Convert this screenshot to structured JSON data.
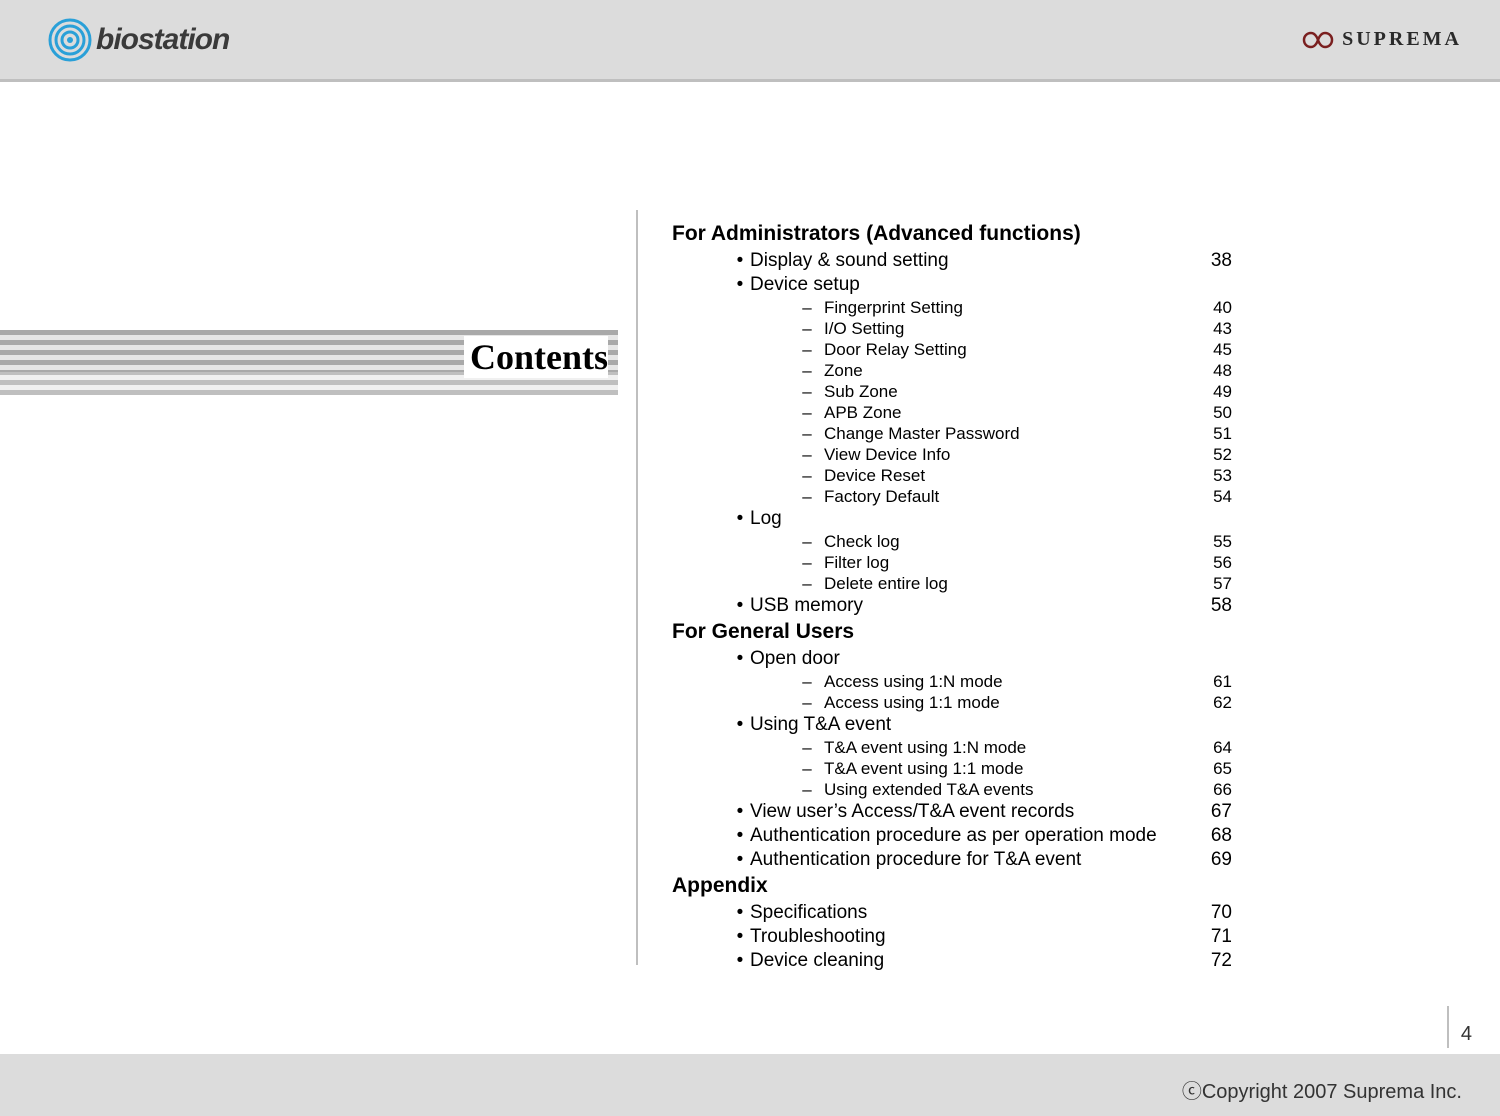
{
  "header": {
    "left_logo_text": "biostation",
    "right_logo_text": "SUPREMA"
  },
  "left": {
    "title": "Contents"
  },
  "toc": {
    "sections": [
      {
        "title": "For Administrators (Advanced functions)",
        "items": [
          {
            "label": "Display & sound setting",
            "page": "38"
          },
          {
            "label": "Device setup",
            "page": "",
            "sub": [
              {
                "label": "Fingerprint Setting",
                "page": "40"
              },
              {
                "label": "I/O Setting",
                "page": "43"
              },
              {
                "label": "Door Relay Setting",
                "page": "45"
              },
              {
                "label": "Zone",
                "page": "48"
              },
              {
                "label": "Sub Zone",
                "page": "49"
              },
              {
                "label": "APB Zone",
                "page": "50"
              },
              {
                "label": "Change Master Password",
                "page": "51"
              },
              {
                "label": "View Device Info",
                "page": "52"
              },
              {
                "label": "Device Reset",
                "page": "53"
              },
              {
                "label": "Factory Default",
                "page": "54"
              }
            ]
          },
          {
            "label": "Log",
            "page": "",
            "sub": [
              {
                "label": "Check log",
                "page": "55"
              },
              {
                "label": "Filter log",
                "page": "56"
              },
              {
                "label": "Delete entire log",
                "page": "57"
              }
            ]
          },
          {
            "label": "USB memory",
            "page": "58"
          }
        ]
      },
      {
        "title": "For General Users",
        "items": [
          {
            "label": "Open door",
            "page": "",
            "sub": [
              {
                "label": "Access using 1:N mode",
                "page": "61"
              },
              {
                "label": "Access using 1:1 mode",
                "page": "62"
              }
            ]
          },
          {
            "label": "Using T&A event",
            "page": "",
            "sub": [
              {
                "label": "T&A event using 1:N mode",
                "page": "64"
              },
              {
                "label": "T&A event using 1:1 mode",
                "page": "65"
              },
              {
                "label": "Using extended T&A events",
                "page": "66"
              }
            ]
          },
          {
            "label": "View user’s Access/T&A event records",
            "page": "67"
          },
          {
            "label": "Authentication procedure as per operation mode",
            "page": "68"
          },
          {
            "label": "Authentication procedure for T&A event",
            "page": "69"
          }
        ]
      },
      {
        "title": "Appendix",
        "items": [
          {
            "label": "Specifications",
            "page": "70"
          },
          {
            "label": "Troubleshooting",
            "page": "71"
          },
          {
            "label": "Device cleaning",
            "page": "72"
          }
        ]
      }
    ]
  },
  "footer": {
    "copyright": "ⓒCopyright 2007 Suprema Inc.",
    "page_number": "4"
  }
}
